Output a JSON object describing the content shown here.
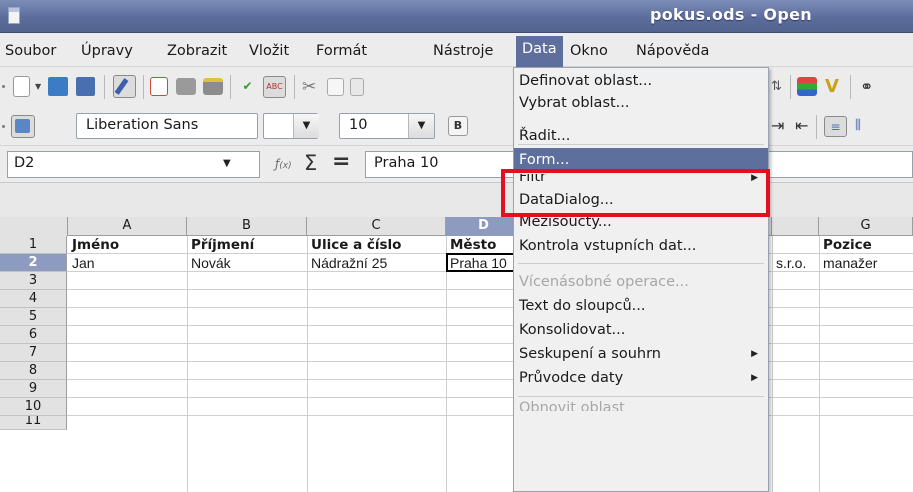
{
  "window": {
    "title": "pokus.ods - Open"
  },
  "menubar": {
    "items": [
      {
        "label": "Soubor",
        "key": "S"
      },
      {
        "label": "Úpravy",
        "key": "p"
      },
      {
        "label": "Zobrazit",
        "key": "Z"
      },
      {
        "label": "Vložit",
        "key": "l"
      },
      {
        "label": "Formát",
        "key": "F"
      },
      {
        "label": "Nástroje",
        "key": "N"
      },
      {
        "label": "Data",
        "key": "D"
      },
      {
        "label": "Okno",
        "key": "O"
      },
      {
        "label": "Nápověda",
        "key": "v"
      }
    ]
  },
  "format_toolbar": {
    "font_name": "Liberation Sans",
    "font_size": "10"
  },
  "formula_bar": {
    "cell_reference": "D2",
    "formula_value": "Praha 10"
  },
  "sheet": {
    "columns": [
      "A",
      "B",
      "C",
      "D",
      "",
      "",
      "G"
    ],
    "selected_column": "D",
    "rows": [
      "1",
      "2",
      "3",
      "4",
      "5",
      "6",
      "7",
      "8",
      "9",
      "10",
      "11"
    ],
    "selected_row": "2",
    "header_row": {
      "A": "Jméno",
      "B": "Příjmení",
      "C": "Ulice a číslo",
      "D": "Město",
      "G": "Pozice"
    },
    "data_row": {
      "A": "Jan",
      "B": "Novák",
      "C": "Nádražní 25",
      "D": "Praha 10",
      "F": "s.r.o.",
      "G": "manažer"
    }
  },
  "data_menu": {
    "items": [
      {
        "label": "Definovat oblast...",
        "state": "normal"
      },
      {
        "label": "Vybrat oblast...",
        "state": "normal"
      },
      {
        "label": "Řadit...",
        "state": "normal"
      },
      {
        "label": "Form...",
        "state": "highlighted"
      },
      {
        "label": "Filtr",
        "state": "normal",
        "submenu": true
      },
      {
        "label": "DataDialog...",
        "state": "normal"
      },
      {
        "label": "Mezisoučty...",
        "state": "normal"
      },
      {
        "label": "Kontrola vstupních dat...",
        "state": "normal"
      },
      {
        "label": "Vícenásobné operace...",
        "state": "disabled"
      },
      {
        "label": "Text do sloupců...",
        "state": "normal"
      },
      {
        "label": "Konsolidovat...",
        "state": "normal"
      },
      {
        "label": "Seskupení a souhrn",
        "state": "normal",
        "submenu": true
      },
      {
        "label": "Průvodce daty",
        "state": "normal",
        "submenu": true
      },
      {
        "label": "Obnovit oblast",
        "state": "disabled"
      }
    ]
  },
  "annotation": {
    "color": "#e3101f",
    "target": "Form..."
  },
  "colors": {
    "menu_highlight": "#5e6f9d",
    "title_bar": "#5c6d9c",
    "selected_header": "#8d9bc0"
  }
}
